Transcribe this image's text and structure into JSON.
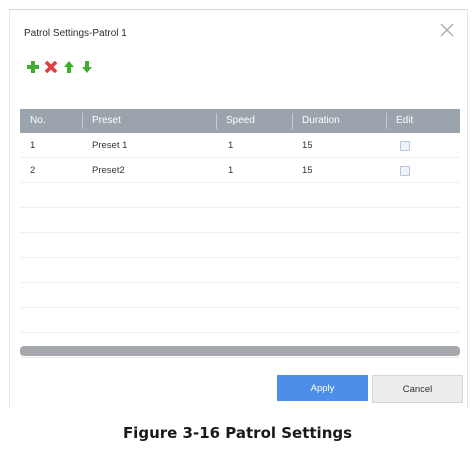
{
  "dialog": {
    "title": "Patrol Settings-Patrol 1",
    "toolbar": {
      "add_icon": "plus-icon",
      "delete_icon": "delete-x-icon",
      "up_icon": "arrow-up-icon",
      "down_icon": "arrow-down-icon"
    },
    "table": {
      "headers": [
        "No.",
        "Preset",
        "Speed",
        "Duration",
        "Edit"
      ],
      "rows": [
        {
          "no": "1",
          "preset": "Preset 1",
          "speed": "1",
          "duration": "15"
        },
        {
          "no": "2",
          "preset": "Preset2",
          "speed": "1",
          "duration": "15"
        }
      ]
    },
    "apply_label": "Apply",
    "cancel_label": "Cancel"
  },
  "caption": "Figure 3-16 Patrol Settings",
  "colors": {
    "header_bg": "#9ba3ad",
    "apply_bg": "#4d8fe8",
    "add_green": "#3fae2f",
    "delete_red": "#e23b3b"
  }
}
